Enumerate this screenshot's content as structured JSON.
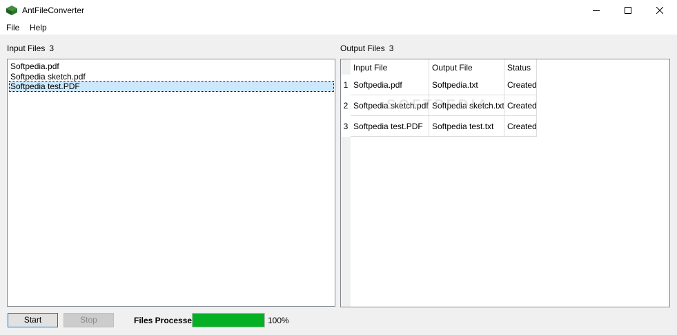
{
  "window": {
    "title": "AntFileConverter",
    "minimize_icon": "minimize-icon",
    "maximize_icon": "maximize-icon",
    "close_icon": "close-icon"
  },
  "menu": [
    "File",
    "Help"
  ],
  "input_pane": {
    "label": "Input Files",
    "count": "3",
    "files": [
      "Softpedia.pdf",
      "Softpedia sketch.pdf",
      "Softpedia test.PDF"
    ],
    "selected_index": 2
  },
  "output_pane": {
    "label": "Output Files",
    "count": "3",
    "columns": [
      "Input File",
      "Output File",
      "Status"
    ],
    "rows": [
      {
        "num": "1",
        "input": "Softpedia.pdf",
        "output": "Softpedia.txt",
        "status": "Created"
      },
      {
        "num": "2",
        "input": "Softpedia sketch.pdf",
        "output": "Softpedia sketch.txt",
        "status": "Created"
      },
      {
        "num": "3",
        "input": "Softpedia test.PDF",
        "output": "Softpedia test.txt",
        "status": "Created"
      }
    ],
    "watermark": "SOFTPEDIA"
  },
  "controls": {
    "start_label": "Start",
    "stop_label": "Stop",
    "progress_label": "Files Processed",
    "progress_percent": "100%",
    "progress_fraction": 1.0,
    "progress_color": "#06b025"
  }
}
